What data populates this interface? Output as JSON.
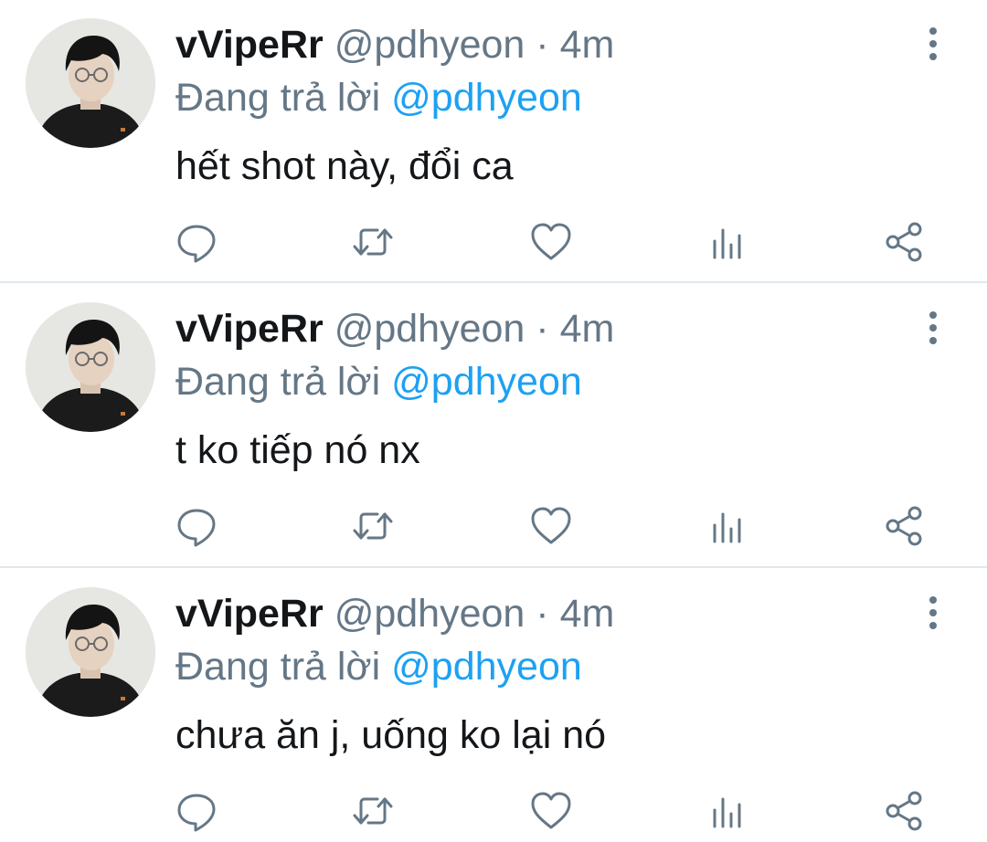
{
  "tweets": [
    {
      "display_name": "vVipeRr",
      "handle": "@pdhyeon",
      "separator": "·",
      "time": "4m",
      "reply_prefix": "Đang trả lời",
      "reply_to": "@pdhyeon",
      "text": "hết shot này, đổi ca"
    },
    {
      "display_name": "vVipeRr",
      "handle": "@pdhyeon",
      "separator": "·",
      "time": "4m",
      "reply_prefix": "Đang trả lời",
      "reply_to": "@pdhyeon",
      "text": "t ko tiếp nó nx"
    },
    {
      "display_name": "vVipeRr",
      "handle": "@pdhyeon",
      "separator": "·",
      "time": "4m",
      "reply_prefix": "Đang trả lời",
      "reply_to": "@pdhyeon",
      "text": "chưa ăn j, uống ko lại nó"
    }
  ],
  "icons": {
    "more": "more-vertical-icon",
    "reply": "reply-icon",
    "retweet": "retweet-icon",
    "like": "heart-icon",
    "views": "analytics-icon",
    "share": "share-icon"
  },
  "colors": {
    "text": "#14171a",
    "secondary": "#657786",
    "link": "#1da1f2",
    "divider": "#e1e8ed",
    "icon": "#657786"
  }
}
